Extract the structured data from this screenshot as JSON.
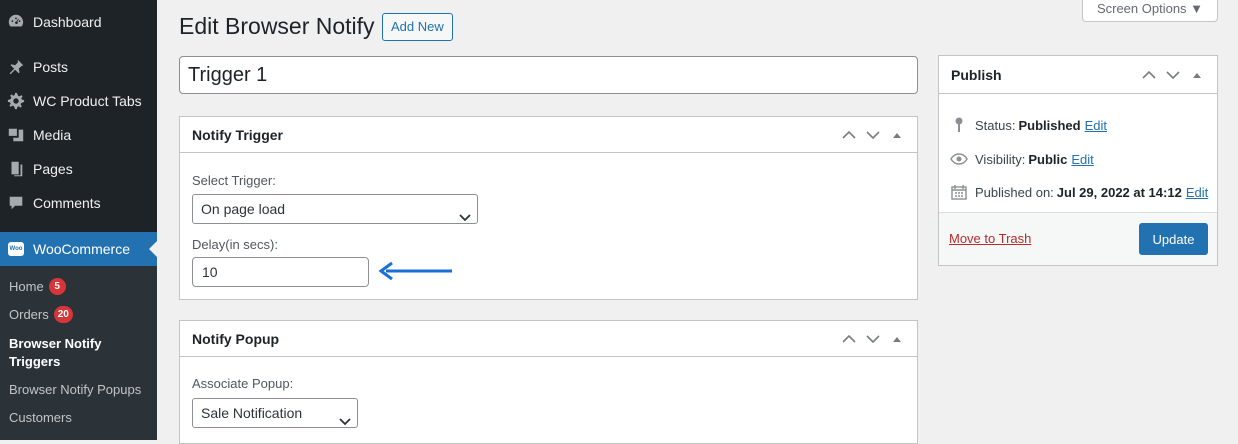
{
  "sidebar": {
    "items": [
      {
        "label": "Dashboard",
        "icon": "dashboard-icon"
      },
      {
        "label": "Posts",
        "icon": "pin-icon"
      },
      {
        "label": "WC Product Tabs",
        "icon": "gear-icon"
      },
      {
        "label": "Media",
        "icon": "media-icon"
      },
      {
        "label": "Pages",
        "icon": "pages-icon"
      },
      {
        "label": "Comments",
        "icon": "comments-icon"
      },
      {
        "label": "WooCommerce",
        "icon": "woo-icon",
        "active": true
      }
    ],
    "woo_icon_text": "Woo",
    "submenu": [
      {
        "label": "Home",
        "badge": "5"
      },
      {
        "label": "Orders",
        "badge": "20"
      },
      {
        "label": "Browser Notify Triggers",
        "current": true
      },
      {
        "label": "Browser Notify Popups"
      },
      {
        "label": "Customers"
      }
    ]
  },
  "header": {
    "title": "Edit Browser Notify",
    "add_new": "Add New",
    "screen_options": "Screen Options ▼"
  },
  "post_title": "Trigger 1",
  "trigger_box": {
    "title": "Notify Trigger",
    "select_label": "Select Trigger:",
    "select_value": "On page load",
    "delay_label": "Delay(in secs):",
    "delay_value": "10"
  },
  "popup_box": {
    "title": "Notify Popup",
    "associate_label": "Associate Popup:",
    "associate_value": "Sale Notification"
  },
  "publish_box": {
    "title": "Publish",
    "status_label": "Status:",
    "status_value": "Published",
    "visibility_label": "Visibility:",
    "visibility_value": "Public",
    "published_label": "Published on:",
    "published_value": "Jul 29, 2022 at 14:12",
    "edit": "Edit",
    "move_to_trash": "Move to Trash",
    "update": "Update"
  },
  "colors": {
    "accent": "#2271b1",
    "sidebar_bg": "#1d2327",
    "badge": "#d63638",
    "trash": "#b32d2e",
    "arrow": "#1a6fd6"
  }
}
